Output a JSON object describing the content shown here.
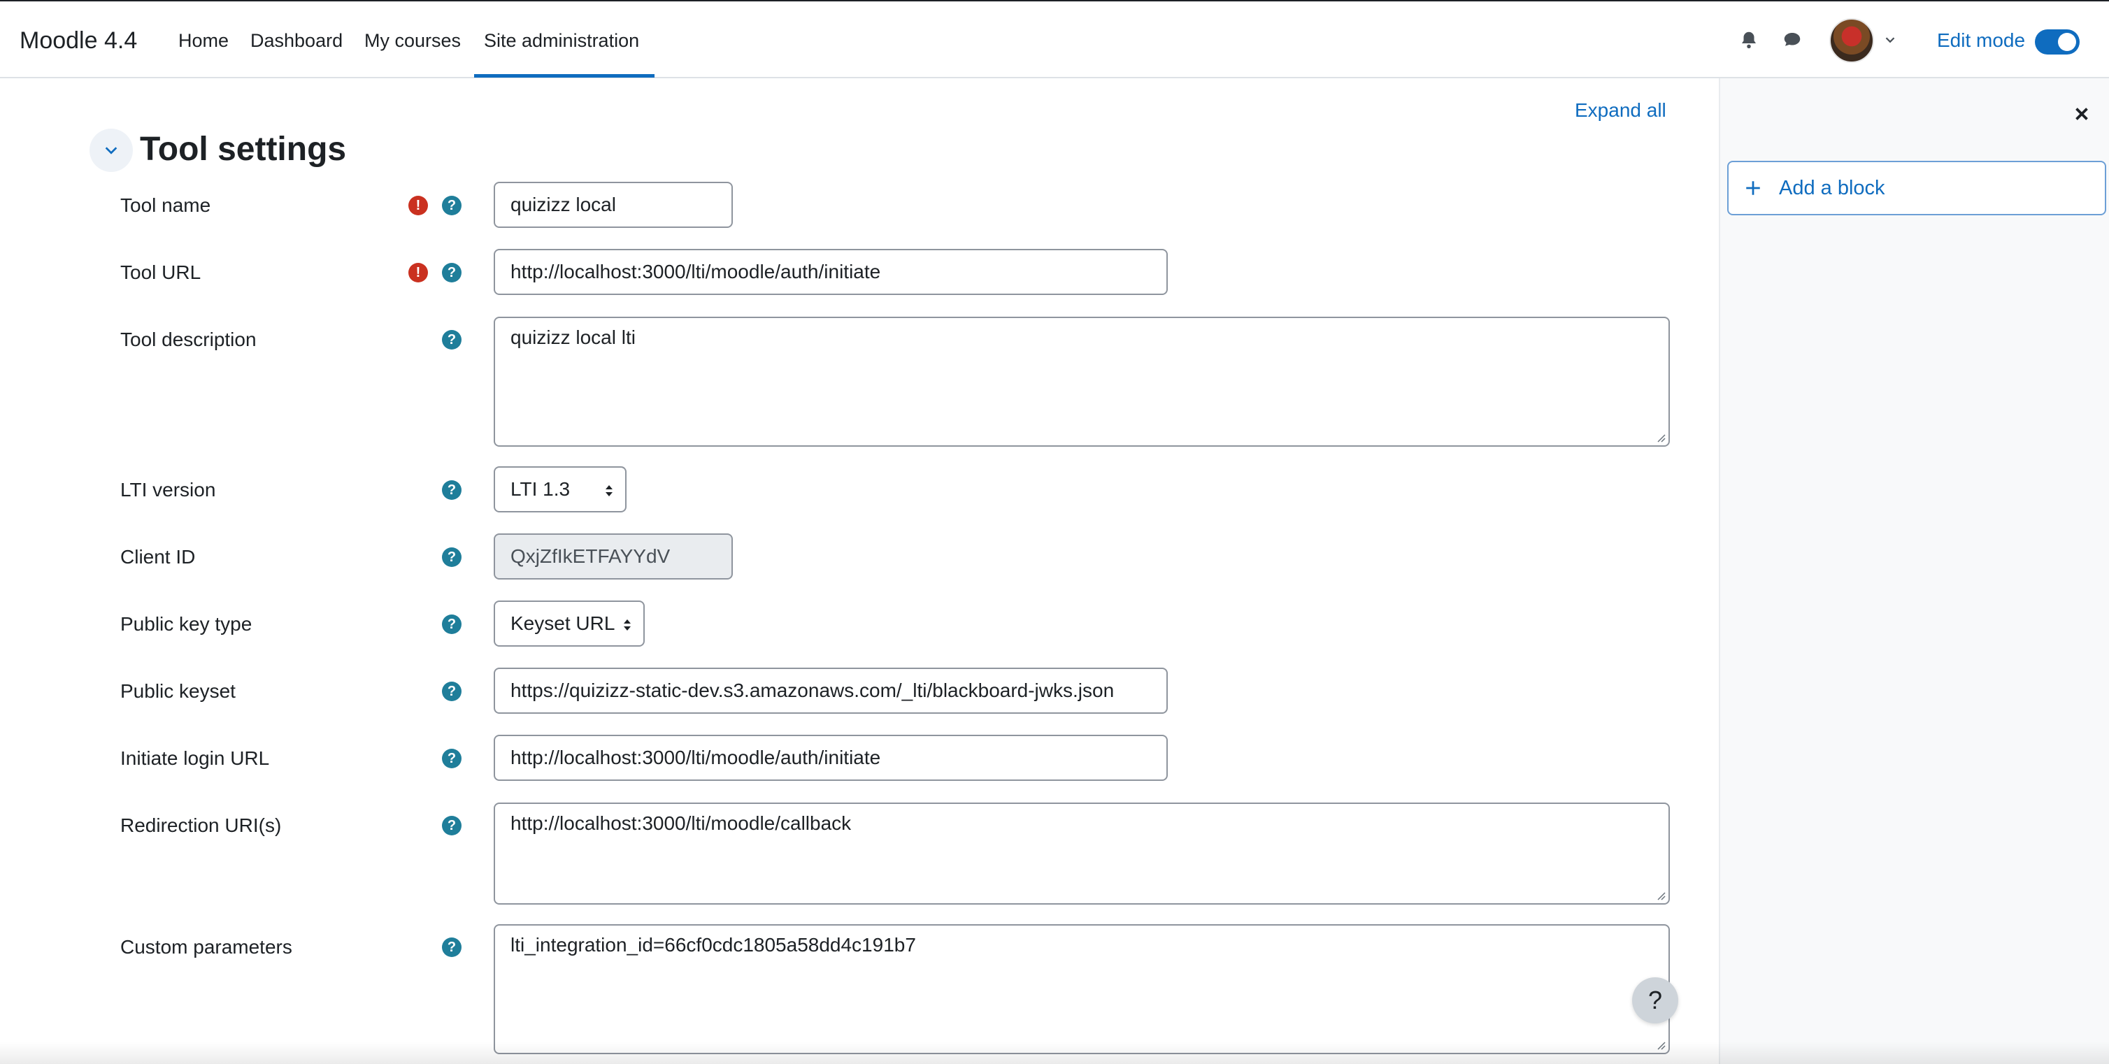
{
  "navbar": {
    "brand": "Moodle 4.4",
    "links": [
      "Home",
      "Dashboard",
      "My courses",
      "Site administration"
    ],
    "active_link": "Site administration",
    "edit_mode_label": "Edit mode",
    "edit_mode_on": true
  },
  "main": {
    "expand_all": "Expand all",
    "section_title": "Tool settings",
    "fields": {
      "tool_name": {
        "label": "Tool name",
        "value": "quizizz local",
        "required": true
      },
      "tool_url": {
        "label": "Tool URL",
        "value": "http://localhost:3000/lti/moodle/auth/initiate",
        "required": true
      },
      "tool_description": {
        "label": "Tool description",
        "value": "quizizz local lti"
      },
      "lti_version": {
        "label": "LTI version",
        "value": "LTI 1.3"
      },
      "client_id": {
        "label": "Client ID",
        "value": "QxjZfIkETFAYYdV"
      },
      "public_key_type": {
        "label": "Public key type",
        "value": "Keyset URL"
      },
      "public_keyset": {
        "label": "Public keyset",
        "value": "https://quizizz-static-dev.s3.amazonaws.com/_lti/blackboard-jwks.json"
      },
      "initiate_login_url": {
        "label": "Initiate login URL",
        "value": "http://localhost:3000/lti/moodle/auth/initiate"
      },
      "redirection_uris": {
        "label": "Redirection URI(s)",
        "value": "http://localhost:3000/lti/moodle/callback"
      },
      "custom_parameters": {
        "label": "Custom parameters",
        "value": "lti_integration_id=66cf0cdc1805a58dd4c191b7"
      }
    }
  },
  "drawer": {
    "add_block": "Add a block"
  },
  "help_fab": "?",
  "colors": {
    "accent": "#0f6cbf",
    "error": "#ca3120",
    "help": "#1f7e9a"
  }
}
